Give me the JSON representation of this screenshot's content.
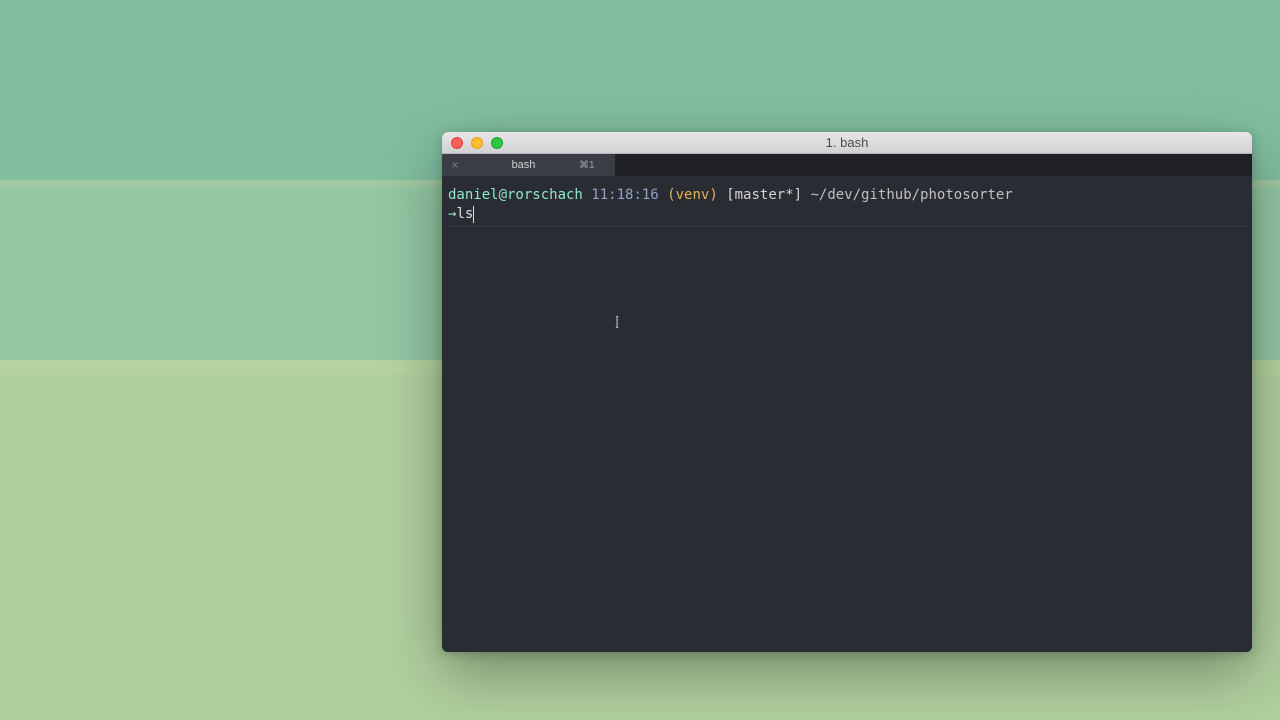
{
  "window": {
    "title": "1. bash"
  },
  "tabs": [
    {
      "label": "bash",
      "shortcut": "⌘1",
      "close_glyph": "×"
    }
  ],
  "prompt": {
    "user_host": "daniel@rorschach",
    "time": "11:18:16",
    "venv": "(venv)",
    "branch": "[master*]",
    "path": "~/dev/github/photosorter",
    "arrow": "→",
    "command_typed": "ls"
  },
  "cursor_glyph": "I"
}
